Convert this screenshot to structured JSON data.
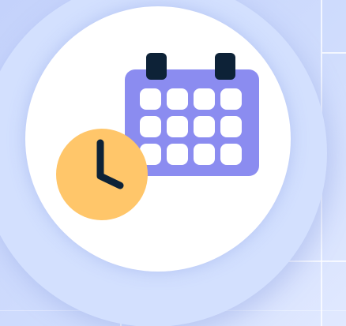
{
  "illustration": {
    "icon": "calendar-clock-icon",
    "colors": {
      "background": "#c7d6fb",
      "outer_disc": "#d3e0fe",
      "inner_disc": "#ffffff",
      "calendar_body": "#8b8cf0",
      "calendar_rings": "#0d2237",
      "calendar_cells": "#ffffff",
      "clock_face": "#ffc66a",
      "clock_hands": "#0d2237"
    },
    "calendar_cell_rows": 3,
    "calendar_cell_cols": 4
  }
}
